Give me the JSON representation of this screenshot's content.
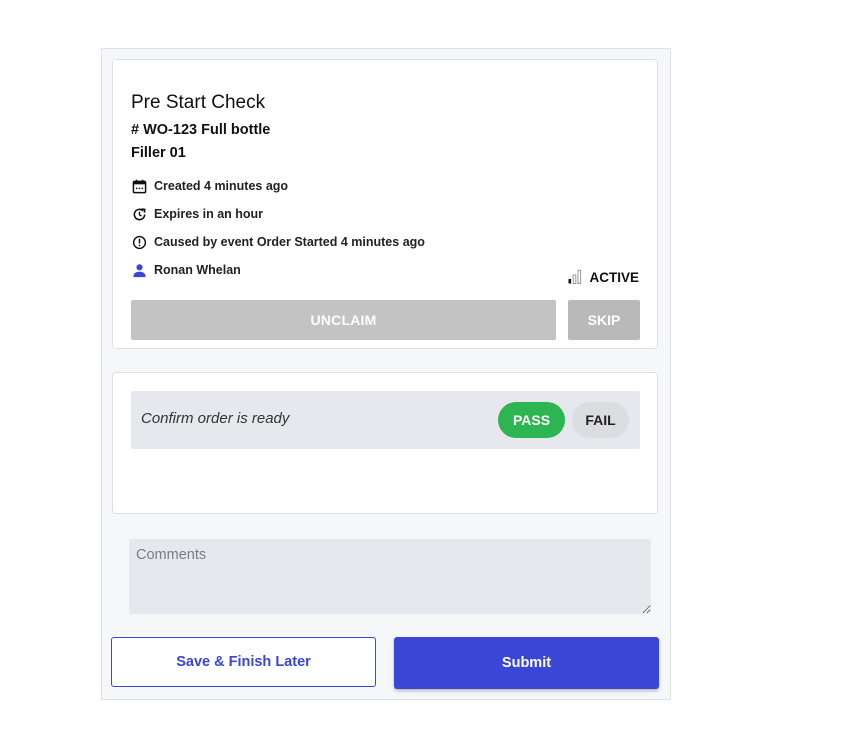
{
  "task": {
    "title": "Pre Start Check",
    "work_order": "# WO-123 Full bottle",
    "asset": "Filler 01",
    "created": "Created 4 minutes ago",
    "expires": "Expires in an hour",
    "caused_by": "Caused by event Order Started 4 minutes ago",
    "assignee": "Ronan Whelan",
    "status": "ACTIVE",
    "unclaim_label": "UNCLAIM",
    "skip_label": "SKIP"
  },
  "checklist": {
    "items": [
      {
        "label": "Confirm order is ready",
        "pass_label": "PASS",
        "fail_label": "FAIL",
        "selected": "PASS"
      }
    ]
  },
  "comments": {
    "placeholder": "Comments",
    "value": ""
  },
  "actions": {
    "save_label": "Save & Finish Later",
    "submit_label": "Submit"
  },
  "colors": {
    "primary": "#3a46d6",
    "pass": "#2db552",
    "disabled": "#c3c3c3",
    "row_bg": "#e6e8ee"
  },
  "icons": {
    "created": "calendar-icon",
    "expires": "clock-refresh-icon",
    "caused_by": "alert-circle-icon",
    "assignee": "person-icon",
    "status": "signal-bars-icon"
  }
}
